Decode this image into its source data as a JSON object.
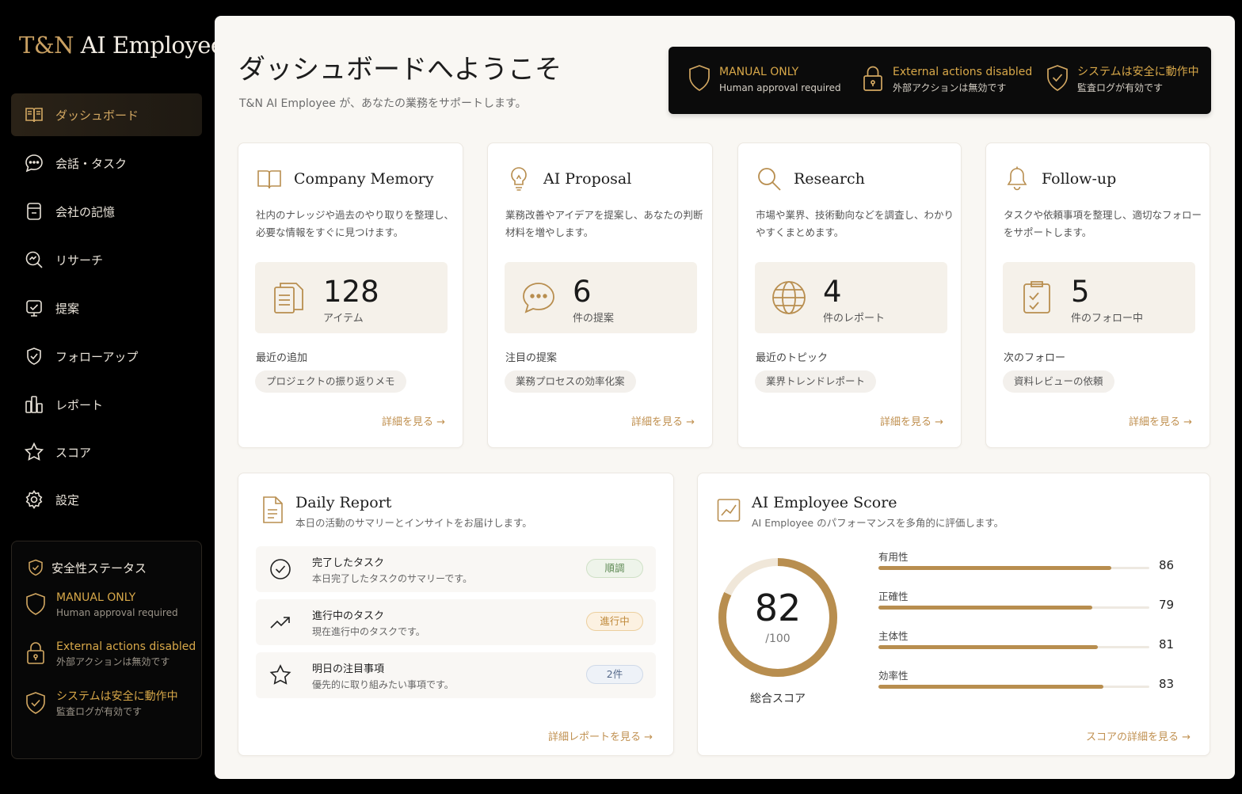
{
  "brand": {
    "prefix": "T&N",
    "suffix": " AI Employee"
  },
  "sidebar": {
    "items": [
      {
        "label": "ダッシュボード",
        "icon": "book-open-icon"
      },
      {
        "label": "会話・タスク",
        "icon": "chat-bubble-icon"
      },
      {
        "label": "会社の記憶",
        "icon": "storage-icon"
      },
      {
        "label": "リサーチ",
        "icon": "search-icon"
      },
      {
        "label": "提案",
        "icon": "proposal-icon"
      },
      {
        "label": "フォローアップ",
        "icon": "follow-up-icon"
      },
      {
        "label": "レポート",
        "icon": "report-icon"
      },
      {
        "label": "スコア",
        "icon": "star-icon"
      },
      {
        "label": "設定",
        "icon": "gear-icon"
      }
    ],
    "safety": {
      "title": "安全性ステータス",
      "items": [
        {
          "main": "MANUAL ONLY",
          "sub": "Human approval required"
        },
        {
          "main": "External actions disabled",
          "sub": "外部アクションは無効です"
        },
        {
          "main": "システムは安全に動作中",
          "sub": "監査ログが有効です"
        }
      ]
    }
  },
  "header": {
    "title": "ダッシュボードへようこそ",
    "subtitle": "T&N AI Employee が、あなたの業務をサポートします。"
  },
  "status_banner": [
    {
      "main": "MANUAL ONLY",
      "sub": "Human approval required"
    },
    {
      "main": "External actions disabled",
      "sub": "外部アクションは無効です"
    },
    {
      "main": "システムは安全に動作中",
      "sub": "監査ログが有効です"
    }
  ],
  "cards": [
    {
      "title": "Company Memory",
      "desc": "社内のナレッジや過去のやり取りを整理し、必要な情報をすぐに見つけます。",
      "value": "128",
      "unit": "アイテム",
      "label": "最近の追加",
      "chip": "プロジェクトの振り返りメモ",
      "link": "詳細を見る →"
    },
    {
      "title": "AI Proposal",
      "desc": "業務改善やアイデアを提案し、あなたの判断材料を増やします。",
      "value": "6",
      "unit": "件の提案",
      "label": "注目の提案",
      "chip": "業務プロセスの効率化案",
      "link": "詳細を見る →"
    },
    {
      "title": "Research",
      "desc": "市場や業界、技術動向などを調査し、わかりやすくまとめます。",
      "value": "4",
      "unit": "件のレポート",
      "label": "最近のトピック",
      "chip": "業界トレンドレポート",
      "link": "詳細を見る →"
    },
    {
      "title": "Follow-up",
      "desc": "タスクや依頼事項を整理し、適切なフォローをサポートします。",
      "value": "5",
      "unit": "件のフォロー中",
      "label": "次のフォロー",
      "chip": "資料レビューの依頼",
      "link": "詳細を見る →"
    }
  ],
  "daily_report": {
    "title": "Daily Report",
    "subtitle": "本日の活動のサマリーとインサイトをお届けします。",
    "rows": [
      {
        "title": "完了したタスク",
        "sub": "本日完了したタスクのサマリーです。",
        "badge": "順調"
      },
      {
        "title": "進行中のタスク",
        "sub": "現在進行中のタスクです。",
        "badge": "進行中"
      },
      {
        "title": "明日の注目事項",
        "sub": "優先的に取り組みたい事項です。",
        "badge": "2件"
      }
    ],
    "link": "詳細レポートを見る →"
  },
  "score": {
    "title": "AI Employee Score",
    "subtitle": "AI Employee のパフォーマンスを多角的に評価します。",
    "total": "82",
    "total_max": "/100",
    "total_value": 82,
    "total_label": "総合スコア",
    "metrics": [
      {
        "label": "有用性",
        "value": 86
      },
      {
        "label": "正確性",
        "value": 79
      },
      {
        "label": "主体性",
        "value": 81
      },
      {
        "label": "効率性",
        "value": 83
      }
    ],
    "link": "スコアの詳細を見る →"
  },
  "colors": {
    "gold": "#c09050",
    "accent": "#d8a849",
    "dark": "#0b0b0b"
  }
}
